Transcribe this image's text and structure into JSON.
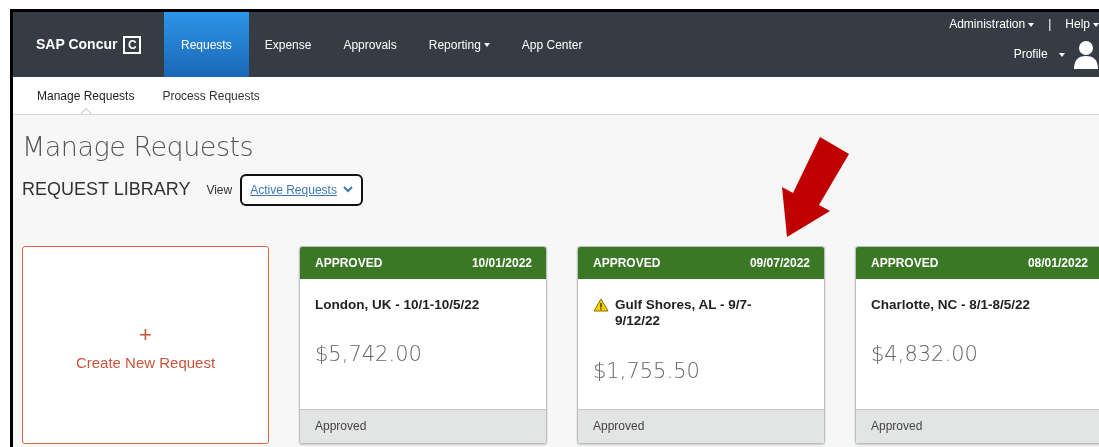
{
  "brand": "SAP Concur",
  "logo_mark": "C",
  "nav": {
    "tabs": [
      {
        "label": "Requests",
        "selected": true,
        "dropdown": false
      },
      {
        "label": "Expense",
        "selected": false,
        "dropdown": false
      },
      {
        "label": "Approvals",
        "selected": false,
        "dropdown": false
      },
      {
        "label": "Reporting",
        "selected": false,
        "dropdown": true
      },
      {
        "label": "App Center",
        "selected": false,
        "dropdown": false
      }
    ],
    "utility_links": [
      {
        "label": "Administration",
        "dropdown": true
      },
      {
        "label": "Help",
        "dropdown": true
      }
    ],
    "separator": "|",
    "profile": {
      "label": "Profile",
      "dropdown": true
    }
  },
  "subnav": [
    {
      "label": "Manage Requests",
      "selected": true
    },
    {
      "label": "Process Requests",
      "selected": false
    }
  ],
  "page_title": "Manage Requests",
  "library": {
    "heading": "REQUEST LIBRARY",
    "view_label": "View",
    "view_value": "Active Requests"
  },
  "create_card": {
    "icon": "+",
    "label": "Create New Request"
  },
  "requests": [
    {
      "status": "APPROVED",
      "date": "10/01/2022",
      "title": "London, UK - 10/1-10/5/22",
      "warning": false,
      "amount": "$5,742.00",
      "footer": "Approved"
    },
    {
      "status": "APPROVED",
      "date": "09/07/2022",
      "title": "Gulf Shores, AL - 9/7-9/12/22",
      "warning": true,
      "amount": "$1,755.50",
      "footer": "Approved"
    },
    {
      "status": "APPROVED",
      "date": "08/01/2022",
      "title": "Charlotte, NC - 8/1-8/5/22",
      "warning": false,
      "amount": "$4,832.00",
      "footer": "Approved"
    }
  ]
}
